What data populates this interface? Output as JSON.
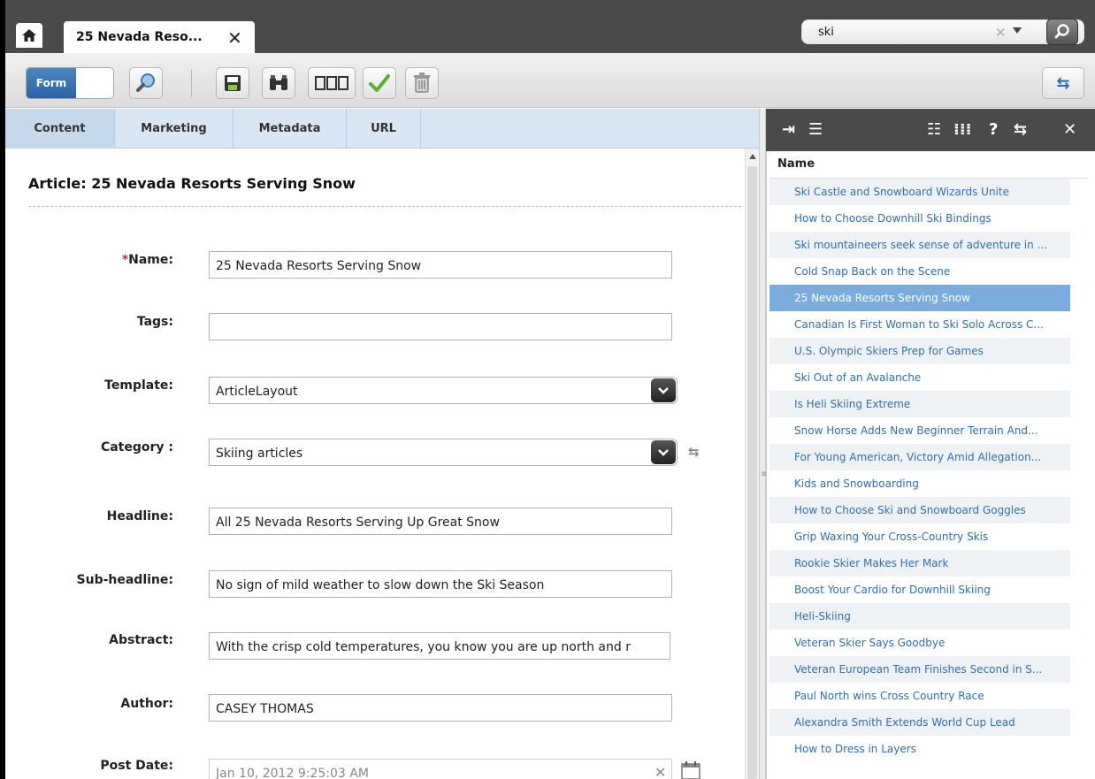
{
  "tab": {
    "title": "25 Nevada Reso...",
    "close": "✕"
  },
  "search": {
    "query": "ski",
    "clear": "✕"
  },
  "toolbar": {
    "toggle_label": "Form"
  },
  "content_tabs": [
    "Content",
    "Marketing",
    "Metadata",
    "URL"
  ],
  "article_title": "Article: 25 Nevada Resorts Serving Snow",
  "form": {
    "name_required": "*",
    "name_label": "Name:",
    "name_value": "25 Nevada Resorts Serving Snow",
    "tags_label": "Tags:",
    "tags_value": "",
    "template_label": "Template:",
    "template_value": "ArticleLayout",
    "category_label": "Category :",
    "category_value": "Skiing articles",
    "headline_label": "Headline:",
    "headline_value": "All 25 Nevada Resorts Serving Up Great Snow",
    "subheadline_label": "Sub-headline:",
    "subheadline_value": "No sign of mild weather to slow down the Ski Season",
    "abstract_label": "Abstract:",
    "abstract_value": "With the crisp cold temperatures, you know you are up north and r",
    "author_label": "Author:",
    "author_value": "CASEY THOMAS",
    "postdate_label": "Post Date:",
    "postdate_value": "Jan 10, 2012 9:25:03 AM",
    "postdate_clear": "✕"
  },
  "panel": {
    "column_header": "Name",
    "selected_index": 4,
    "items": [
      "Ski Castle and Snowboard Wizards Unite",
      "How to Choose Downhill Ski Bindings",
      "Ski mountaineers seek sense of adventure in ...",
      "Cold Snap Back on the Scene",
      "25 Nevada Resorts Serving Snow",
      "Canadian Is First Woman to Ski Solo Across C...",
      "U.S. Olympic Skiers Prep for Games",
      "Ski Out of an Avalanche",
      "Is Heli Skiing Extreme",
      "Snow Horse Adds New Beginner Terrain And...",
      "For Young American, Victory Amid Allegation...",
      "Kids and Snowboarding",
      "How to Choose Ski and Snowboard Goggles",
      "Grip Waxing Your Cross-Country Skis",
      "Rookie Skier Makes Her Mark",
      "Boost Your Cardio for Downhill Skiing",
      "Heli-Skiing",
      "Veteran Skier Says Goodbye",
      "Veteran European Team Finishes Second in S...",
      "Paul North wins Cross Country Race",
      "Alexandra Smith Extends World Cup Lead",
      "How to Dress in Layers"
    ]
  },
  "colors": {
    "accent": "#2c62a3",
    "link": "#2f6fb3",
    "selected_row": "#7aaddd",
    "tab_strip": "#d9e6f3",
    "header_dark": "#4a4a4a"
  }
}
